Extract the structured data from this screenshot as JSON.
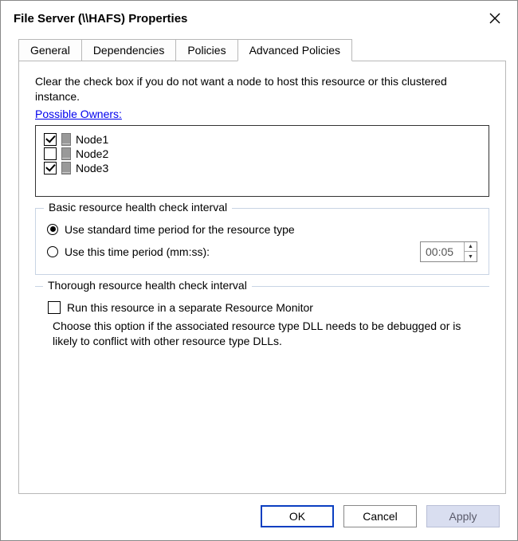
{
  "window": {
    "title": "File Server (\\\\HAFS) Properties"
  },
  "tabs": [
    {
      "label": "General"
    },
    {
      "label": "Dependencies"
    },
    {
      "label": "Policies"
    },
    {
      "label": "Advanced Policies"
    }
  ],
  "advanced": {
    "intro": "Clear the check box if you do not want a node to host this resource or this clustered instance.",
    "possible_owners_link": "Possible Owners:",
    "owners": [
      {
        "name": "Node1",
        "checked": true
      },
      {
        "name": "Node2",
        "checked": false
      },
      {
        "name": "Node3",
        "checked": true
      }
    ],
    "basic_group": {
      "title": "Basic resource health check interval",
      "option_standard": "Use standard time period for the resource type",
      "option_custom": "Use this time period (mm:ss):",
      "selected": "standard",
      "time_value": "00:05"
    },
    "thorough_group": {
      "title": "Thorough resource health check interval",
      "separate_monitor_label": "Run this resource in a separate Resource Monitor",
      "separate_monitor_checked": false,
      "description": "Choose this option if the associated resource type DLL needs to be debugged or is likely to conflict with other resource type DLLs."
    }
  },
  "buttons": {
    "ok": "OK",
    "cancel": "Cancel",
    "apply": "Apply"
  }
}
